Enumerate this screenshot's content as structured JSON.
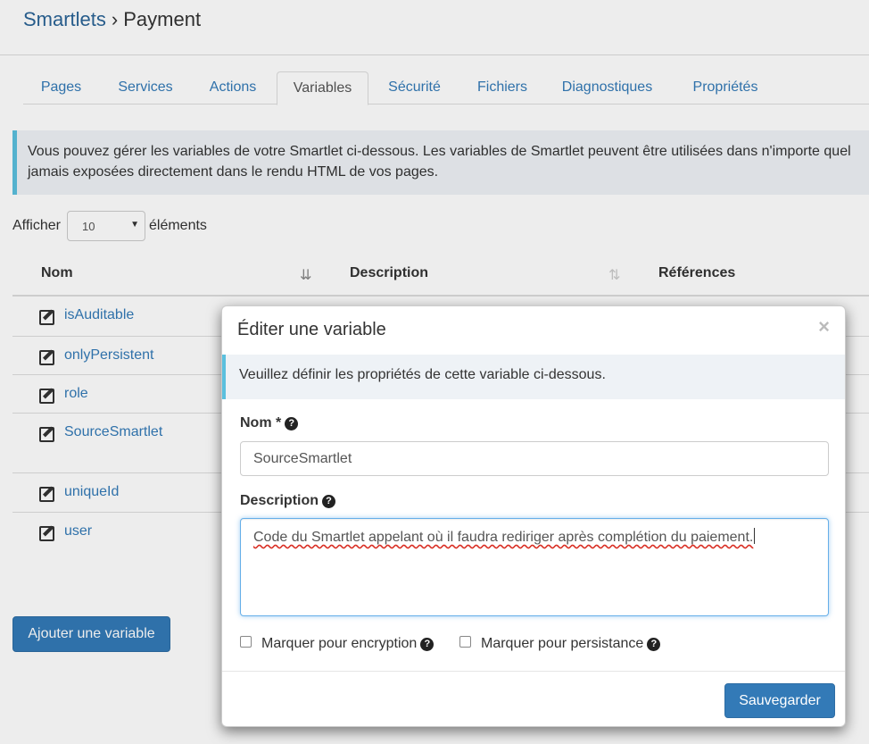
{
  "breadcrumb": {
    "parent": "Smartlets",
    "separator": "›",
    "current": "Payment"
  },
  "tabs": [
    {
      "label": "Pages",
      "active": false
    },
    {
      "label": "Services",
      "active": false
    },
    {
      "label": "Actions",
      "active": false
    },
    {
      "label": "Variables",
      "active": true
    },
    {
      "label": "Sécurité",
      "active": false
    },
    {
      "label": "Fichiers",
      "active": false
    },
    {
      "label": "Diagnostiques",
      "active": false
    },
    {
      "label": "Propriétés",
      "active": false
    }
  ],
  "info": {
    "line1": "Vous pouvez gérer les variables de votre Smartlet ci-dessous. Les variables de Smartlet peuvent être utilisées dans n'importe quel",
    "line2": "jamais exposées directement dans le rendu HTML de vos pages."
  },
  "length": {
    "before": "Afficher",
    "value": "10",
    "after": "éléments"
  },
  "table": {
    "headers": [
      "Nom",
      "Description",
      "Références"
    ],
    "rows": [
      {
        "name": "isAuditable"
      },
      {
        "name": "onlyPersistent"
      },
      {
        "name": "role"
      },
      {
        "name": "SourceSmartlet"
      },
      {
        "name": "uniqueId"
      },
      {
        "name": "user"
      }
    ]
  },
  "add_button": "Ajouter une variable",
  "modal": {
    "title": "Éditer une variable",
    "close": "×",
    "info": "Veuillez définir les propriétés de cette variable ci-dessous.",
    "name_label": "Nom *",
    "name_value": "SourceSmartlet",
    "desc_label": "Description",
    "desc_value": "Code du Smartlet appelant où il faudra rediriger après complétion du paiement.",
    "encrypt_label": "Marquer pour encryption",
    "persist_label": "Marquer pour persistance",
    "help_glyph": "?",
    "save": "Sauvegarder"
  },
  "colors": {
    "accent": "#337ab7",
    "info_border": "#5bc0de",
    "info_bg": "#eef2f6"
  }
}
